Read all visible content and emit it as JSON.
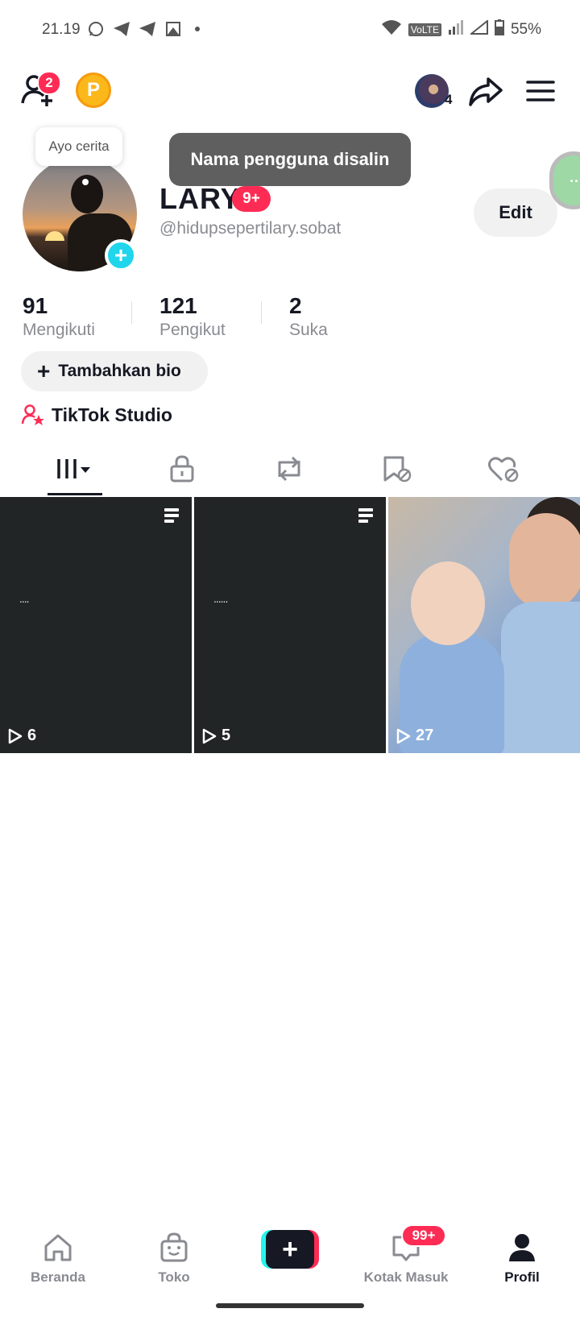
{
  "status_bar": {
    "time": "21.19",
    "network": "VoLTE",
    "battery": "55%",
    "notification_icons": [
      "whatsapp-icon",
      "telegram-icon",
      "telegram-icon",
      "image-icon"
    ]
  },
  "top_bar": {
    "friend_requests_badge": "2",
    "coin_label": "P",
    "account_switch_count": "4"
  },
  "toast": {
    "message": "Nama pengguna disalin"
  },
  "story_bubble": {
    "label": "Ayo cerita"
  },
  "profile": {
    "display_name": "LARY",
    "name_badge": "9+",
    "handle": "@hidupsepertilary.sobat",
    "edit_label": "Edit"
  },
  "stats": [
    {
      "value": "91",
      "label": "Mengikuti"
    },
    {
      "value": "121",
      "label": "Pengikut"
    },
    {
      "value": "2",
      "label": "Suka"
    }
  ],
  "bio_button": {
    "plus": "+",
    "label": "Tambahkan bio"
  },
  "studio": {
    "label": "TikTok Studio"
  },
  "tabs": [
    {
      "name": "videos",
      "icon": "grid-icon",
      "active": true
    },
    {
      "name": "private",
      "icon": "lock-icon",
      "active": false
    },
    {
      "name": "reposts",
      "icon": "repost-icon",
      "active": false
    },
    {
      "name": "favorites",
      "icon": "bookmark-hidden-icon",
      "active": false
    },
    {
      "name": "liked",
      "icon": "heart-hidden-icon",
      "active": false
    }
  ],
  "videos": [
    {
      "views": "6",
      "caption": "....",
      "type": "text-post"
    },
    {
      "views": "5",
      "caption": "......",
      "type": "text-post"
    },
    {
      "views": "27",
      "type": "photo"
    }
  ],
  "bottom_nav": [
    {
      "label": "Beranda",
      "icon": "home-icon",
      "active": false
    },
    {
      "label": "Toko",
      "icon": "shop-bag-icon",
      "active": false
    },
    {
      "label": "",
      "icon": "create-plus-icon",
      "active": false
    },
    {
      "label": "Kotak Masuk",
      "icon": "inbox-icon",
      "active": false,
      "badge": "99+"
    },
    {
      "label": "Profil",
      "icon": "profile-icon",
      "active": true
    }
  ],
  "create_button": {
    "label": "+"
  },
  "colors": {
    "accent": "#fe2c55",
    "cyan": "#25f4ee",
    "text": "#161823",
    "muted": "#8a8b91"
  }
}
